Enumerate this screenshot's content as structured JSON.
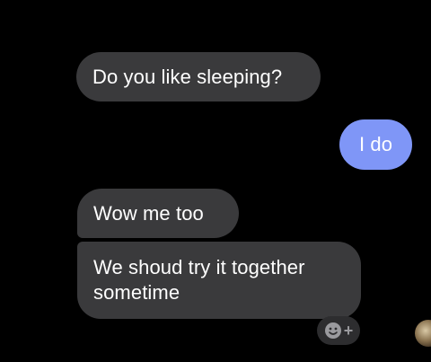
{
  "conversation": {
    "messages": [
      {
        "direction": "incoming",
        "text": "Do you like sleeping?"
      },
      {
        "direction": "outgoing",
        "text": "I do"
      },
      {
        "direction": "incoming",
        "text": "Wow me too"
      },
      {
        "direction": "incoming",
        "text": "We shoud try it together sometime"
      }
    ]
  },
  "reaction_button": {
    "icon": "smiley-add-icon",
    "plus": "+"
  },
  "colors": {
    "background": "#000000",
    "incoming_bubble": "#3a3a3c",
    "outgoing_bubble": "#7f96f7",
    "text": "#ffffff"
  }
}
